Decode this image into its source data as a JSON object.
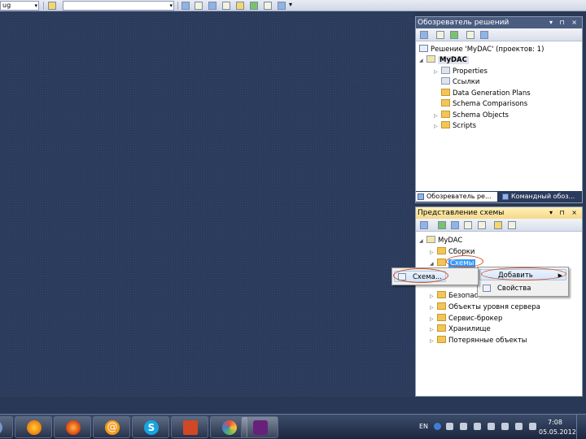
{
  "toolbar": {
    "config_combo": "ug",
    "secondary_combo": ""
  },
  "solution_explorer": {
    "title": "Обозреватель решений",
    "title_buttons": "▾ ⊓ ×",
    "solution_label": "Решение 'MyDAC' (проектов: 1)",
    "project": "MyDAC",
    "items": [
      {
        "label": "Properties"
      },
      {
        "label": "Ссылки"
      },
      {
        "label": "Data Generation Plans"
      },
      {
        "label": "Schema Comparisons"
      },
      {
        "label": "Schema Objects"
      },
      {
        "label": "Scripts"
      }
    ],
    "tabs": [
      {
        "label": "Обозреватель ре..."
      },
      {
        "label": "Командный обоз..."
      }
    ]
  },
  "schema_view": {
    "title": "Представление схемы",
    "title_buttons": "▾ ⊓ ×",
    "root": "MyDAC",
    "items": [
      {
        "label": "Сборки"
      },
      {
        "label": "Схемы"
      },
      {
        "label": "Безопас"
      },
      {
        "label": "Объекты уровня сервера"
      },
      {
        "label": "Сервис-брокер"
      },
      {
        "label": "Хранилище"
      },
      {
        "label": "Потерянные объекты"
      }
    ]
  },
  "context_menu": {
    "items": [
      {
        "label": "Добавить"
      },
      {
        "label": "Свойства"
      }
    ]
  },
  "submenu": {
    "items": [
      {
        "label": "Схема..."
      }
    ]
  },
  "taskbar": {
    "language": "EN",
    "time": "7:08",
    "date": "05.05.2012"
  }
}
